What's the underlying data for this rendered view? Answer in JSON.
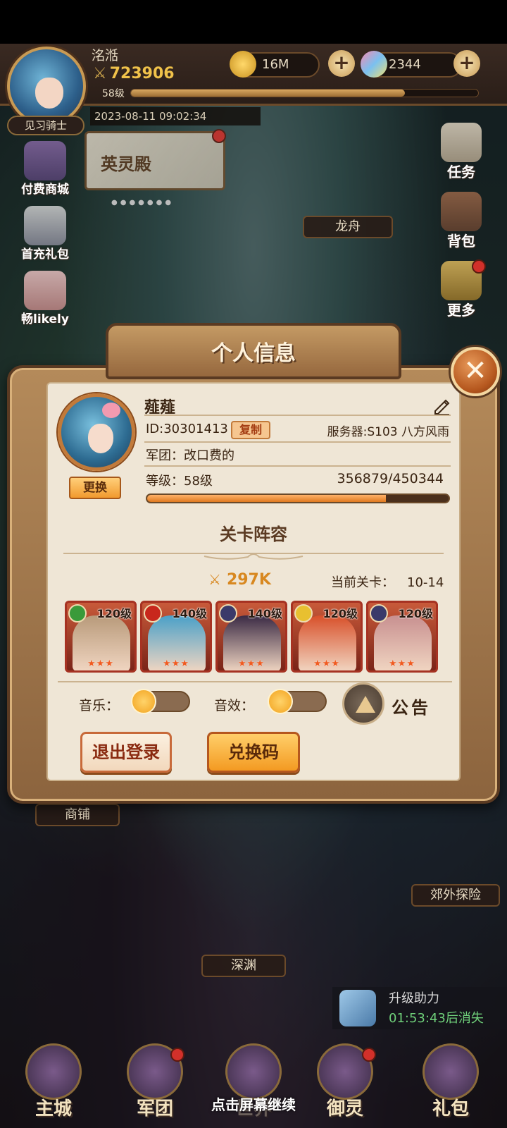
{
  "top": {
    "player_name": "洺湉",
    "power": "723906",
    "level": "58级",
    "title": "见习骑士",
    "date": "2023-08-11 09:02:34",
    "gold": "16M",
    "gems": "2344",
    "xp_fraction": 0.79
  },
  "left_menu": [
    {
      "label": "付费商城"
    },
    {
      "label": "首充礼包"
    },
    {
      "label": "畅likely"
    }
  ],
  "banner": {
    "title": "英灵殿"
  },
  "right_menu": [
    {
      "label": "任务"
    },
    {
      "label": "背包"
    },
    {
      "label": "更多"
    }
  ],
  "map_labels": {
    "dragon_boat": "龙舟",
    "shop": "商铺",
    "abyss": "深渊",
    "outskirts": "郊外探险"
  },
  "boost": {
    "title": "升级助力",
    "timer": "01:53:43后消失"
  },
  "bottom_nav": [
    {
      "label": "主城"
    },
    {
      "label": "军团"
    },
    {
      "label": "世界"
    },
    {
      "label": "御灵"
    },
    {
      "label": "礼包"
    }
  ],
  "tap_hint": "点击屏幕继续",
  "modal": {
    "title": "个人信息",
    "name": "薤薤",
    "id_text": "ID:30301413",
    "copy_label": "复制",
    "server": "服务器:S103 八方风雨",
    "legion": "军团：改口费的",
    "level": "等级：58级",
    "exp": "356879/450344",
    "exp_fraction": 0.7925,
    "change_label": "更换",
    "lineup_title": "关卡阵容",
    "lineup_power": "297K",
    "stage_label": "当前关卡：",
    "stage_value": "10-14",
    "heroes": [
      {
        "level": "120级",
        "stars": "★★★",
        "element_color": "#3a9a3a",
        "art_color": "#b89a7a"
      },
      {
        "level": "140级",
        "stars": "★★★",
        "element_color": "#c8281c",
        "art_color": "#4aa0c8"
      },
      {
        "level": "140级",
        "stars": "★★★",
        "element_color": "#3a3a6a",
        "art_color": "#3a2a44"
      },
      {
        "level": "120级",
        "stars": "★★★",
        "element_color": "#e8c030",
        "art_color": "#d8502a"
      },
      {
        "level": "120级",
        "stars": "★★★",
        "element_color": "#3a3a6a",
        "art_color": "#c89090"
      }
    ],
    "music_label": "音乐：",
    "sfx_label": "音效：",
    "notice_label": "公告",
    "logout_label": "退出登录",
    "redeem_label": "兑换码"
  }
}
